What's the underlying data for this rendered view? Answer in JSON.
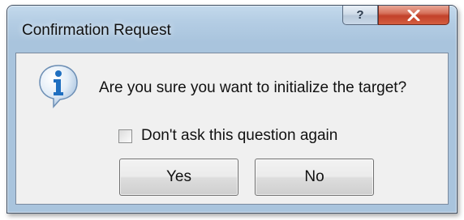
{
  "window": {
    "title": "Confirmation Request",
    "help_label": "?"
  },
  "dialog": {
    "icon": "information-icon",
    "message": "Are you sure you want to initialize the target?",
    "checkbox": {
      "label": "Don't ask this question again",
      "checked": false
    },
    "buttons": {
      "yes": "Yes",
      "no": "No"
    }
  },
  "colors": {
    "frame": "#a9c4dd",
    "client": "#f0f0f0",
    "close_button": "#c2412a",
    "info_icon": "#1f6fc0"
  }
}
